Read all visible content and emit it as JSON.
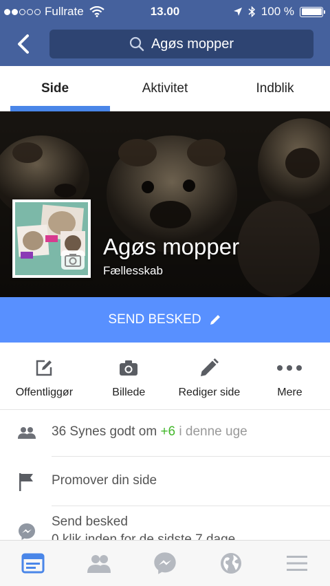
{
  "status_bar": {
    "carrier": "Fullrate",
    "time": "13.00",
    "battery": "100 %",
    "battery_level": 1.0,
    "signal_bars": 2
  },
  "nav": {
    "search_text": "Agøs mopper"
  },
  "tabs": [
    {
      "label": "Side",
      "active": true
    },
    {
      "label": "Aktivitet",
      "active": false
    },
    {
      "label": "Indblik",
      "active": false
    }
  ],
  "cover": {
    "page_name": "Agøs mopper",
    "category": "Fællesskab"
  },
  "send_message": {
    "label": "SEND BESKED"
  },
  "actions": [
    {
      "label": "Offentliggør",
      "icon": "compose-icon"
    },
    {
      "label": "Billede",
      "icon": "camera-icon"
    },
    {
      "label": "Rediger side",
      "icon": "pencil-icon"
    },
    {
      "label": "Mere",
      "icon": "more-dots-icon"
    }
  ],
  "list": {
    "likes": {
      "text": "36 Synes godt om",
      "delta": "+6",
      "suffix": "i denne uge"
    },
    "promote": {
      "text": "Promover din side"
    },
    "messages": {
      "text": "Send besked",
      "sub": "0 klik inden for de sidste 7 dage"
    }
  },
  "bottom_nav": [
    {
      "icon": "news-feed-icon",
      "active": true
    },
    {
      "icon": "friends-icon",
      "active": false
    },
    {
      "icon": "messenger-icon",
      "active": false
    },
    {
      "icon": "globe-icon",
      "active": false
    },
    {
      "icon": "menu-icon",
      "active": false
    }
  ],
  "colors": {
    "header": "#45619d",
    "accent": "#5890ff",
    "tab_underline": "#4a86e8",
    "positive": "#42b72a"
  }
}
